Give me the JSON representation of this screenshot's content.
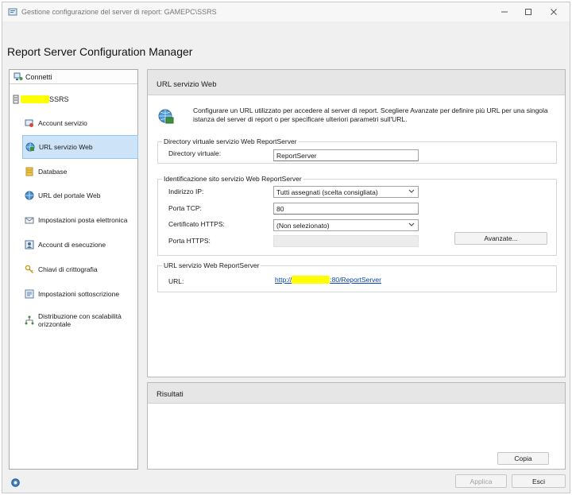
{
  "window": {
    "title": "Gestione configurazione del server di report: GAMEPC\\SSRS",
    "app_title": "Report Server Configuration Manager"
  },
  "connect": {
    "label": "Connetti",
    "server_suffix": "SSRS"
  },
  "nav": {
    "items": [
      {
        "label": "Account servizio",
        "icon": "service-account-icon"
      },
      {
        "label": "URL servizio Web",
        "icon": "web-service-url-icon",
        "selected": true
      },
      {
        "label": "Database",
        "icon": "database-icon"
      },
      {
        "label": "URL del portale Web",
        "icon": "web-portal-url-icon"
      },
      {
        "label": "Impostazioni posta elettronica",
        "icon": "email-settings-icon"
      },
      {
        "label": "Account di esecuzione",
        "icon": "execution-account-icon"
      },
      {
        "label": "Chiavi di crittografia",
        "icon": "encryption-keys-icon"
      },
      {
        "label": "Impostazioni sottoscrizione",
        "icon": "subscription-settings-icon"
      },
      {
        "label": "Distribuzione con scalabilità orizzontale",
        "icon": "scale-out-deployment-icon"
      }
    ]
  },
  "main": {
    "section_title": "URL servizio Web",
    "intro": "Configurare un URL utilizzato per accedere al server di report. Scegliere Avanzate per definire più URL per una singola istanza del server di report o per specificare ulteriori parametri sull'URL.",
    "vdir": {
      "group_title": "Directory virtuale servizio Web ReportServer",
      "label": "Directory virtuale:",
      "value": "ReportServer"
    },
    "site": {
      "group_title": "Identificazione sito servizio Web ReportServer",
      "ip_label": "Indirizzo IP:",
      "ip_value": "Tutti assegnati (scelta consigliata)",
      "tcp_label": "Porta TCP:",
      "tcp_value": "80",
      "cert_label": "Certificato HTTPS:",
      "cert_value": "(Non selezionato)",
      "https_label": "Porta HTTPS:",
      "https_value": "",
      "advanced_label": "Avanzate..."
    },
    "urls": {
      "group_title": "URL servizio Web ReportServer",
      "label": "URL:",
      "link_prefix": "http://",
      "link_suffix": ":80/ReportServer"
    }
  },
  "results": {
    "title": "Risultati",
    "copy_label": "Copia"
  },
  "footer": {
    "apply_label": "Applica",
    "exit_label": "Esci"
  },
  "colors": {
    "selection": "#cde3f7",
    "link": "#0645ad",
    "redaction": "#ffff00"
  }
}
